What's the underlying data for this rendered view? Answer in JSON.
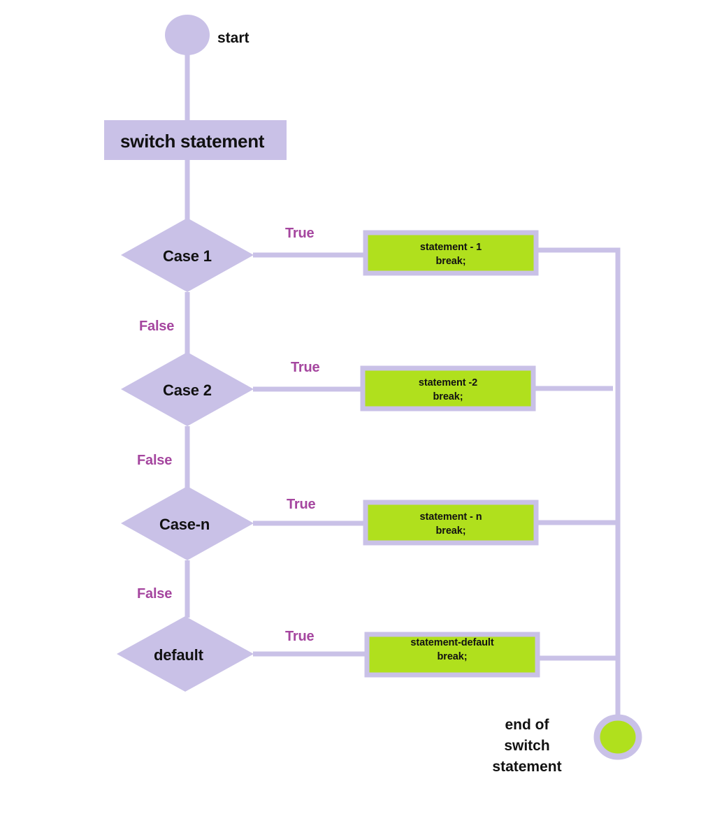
{
  "diagram": {
    "title": "switch statement flowchart",
    "colors": {
      "lavender": "#c9c1e7",
      "green": "#b0e01d",
      "label_magenta": "#a5469f",
      "text_black": "#111111",
      "background": "#ffffff"
    },
    "start": {
      "label": "start",
      "shape": "circle"
    },
    "process": {
      "label": "switch statement",
      "shape": "rectangle"
    },
    "branches": [
      {
        "condition": "Case 1",
        "true_label": "True",
        "false_label": "False",
        "statement_line1": "statement - 1",
        "statement_line2": "break;"
      },
      {
        "condition": "Case 2",
        "true_label": "True",
        "false_label": "False",
        "statement_line1": "statement -2",
        "statement_line2": "break;"
      },
      {
        "condition": "Case-n",
        "true_label": "True",
        "false_label": "False",
        "statement_line1": "statement - n",
        "statement_line2": "break;"
      },
      {
        "condition": "default",
        "true_label": "True",
        "false_label": "",
        "statement_line1": "statement-default",
        "statement_line2": "break;"
      }
    ],
    "end": {
      "label_line1": "end of",
      "label_line2": "switch",
      "label_line3": "statement",
      "shape": "circle"
    }
  }
}
